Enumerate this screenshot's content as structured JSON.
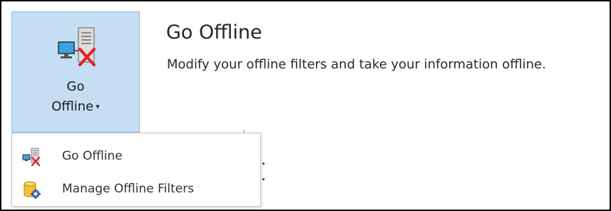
{
  "ribbon": {
    "go_offline_button": {
      "line1": "Go",
      "line2": "Offline",
      "caret": "▾",
      "icon": "computer-server-offline-icon"
    }
  },
  "tooltip": {
    "title": "Go Offline",
    "description": "Modify your offline filters and take your information offline."
  },
  "dropdown": {
    "items": [
      {
        "label": "Go Offline",
        "icon": "go-offline-icon"
      },
      {
        "label": "Manage Offline Filters",
        "icon": "database-gear-icon"
      }
    ]
  },
  "colors": {
    "button_selected_bg": "#c5def3",
    "button_selected_border": "#8fbbe3",
    "offline_x": "#e0202a"
  }
}
